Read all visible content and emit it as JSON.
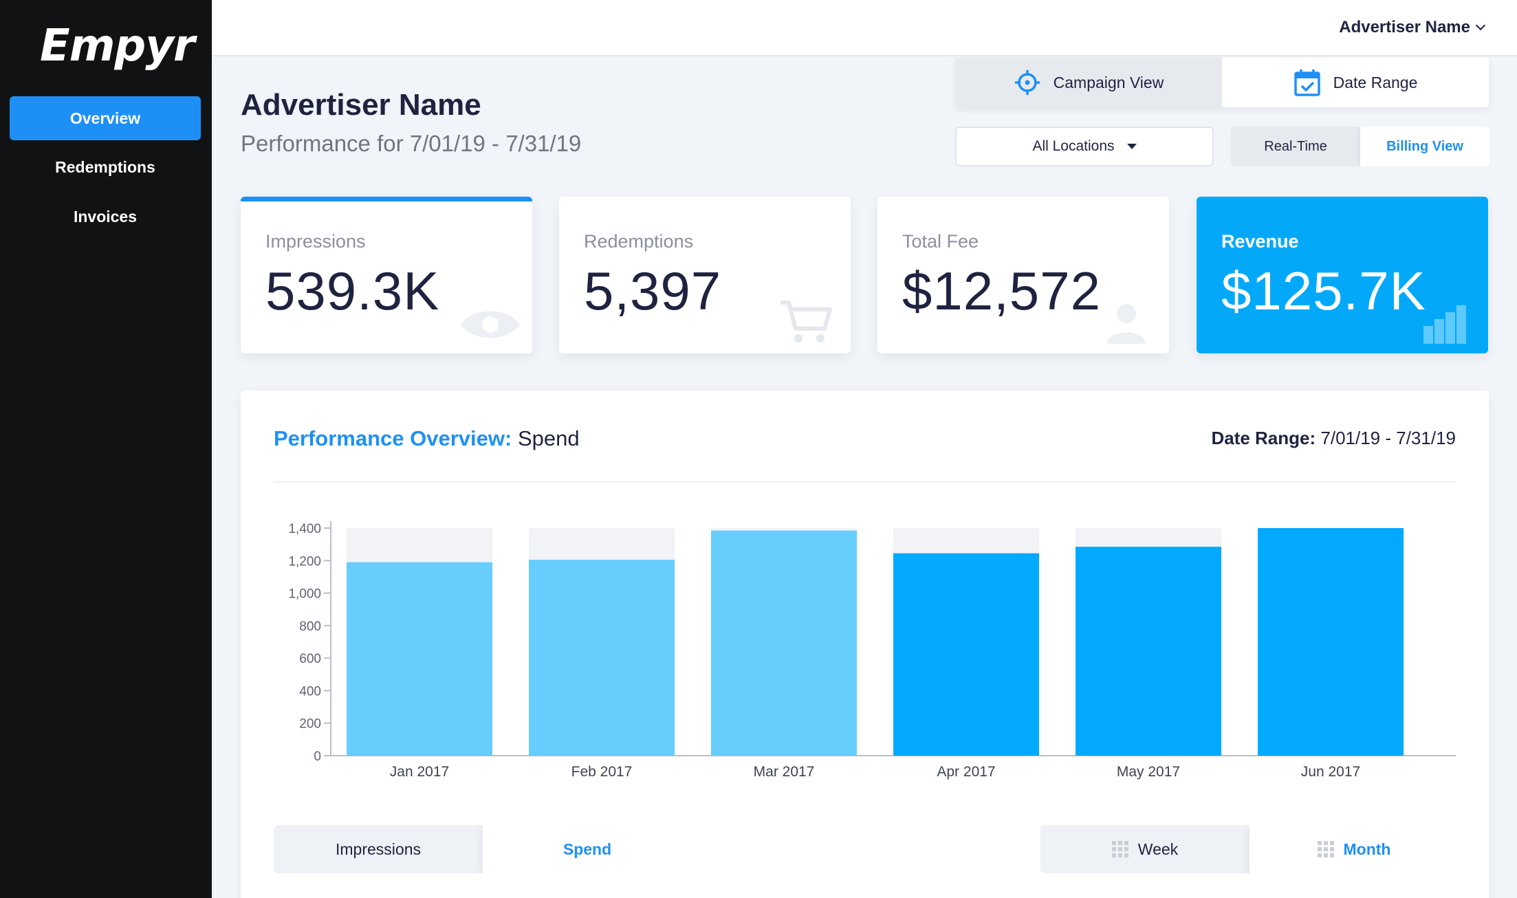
{
  "brand": "Empyr",
  "sidebar": {
    "items": [
      {
        "label": "Overview"
      },
      {
        "label": "Redemptions"
      },
      {
        "label": "Invoices"
      }
    ]
  },
  "topbar": {
    "user_label": "Advertiser Name"
  },
  "header": {
    "title": "Advertiser Name",
    "subtitle": "Performance for 7/01/19 - 7/31/19"
  },
  "view_tabs": [
    {
      "label": "Campaign View",
      "icon": "crosshair-icon"
    },
    {
      "label": "Date Range",
      "icon": "calendar-check-icon"
    }
  ],
  "location_select": {
    "value": "All Locations"
  },
  "mode_toggle": [
    "Real-Time",
    "Billing View"
  ],
  "stats": [
    {
      "label": "Impressions",
      "value": "539.3K",
      "icon": "eye-icon"
    },
    {
      "label": "Redemptions",
      "value": "5,397",
      "icon": "cart-icon"
    },
    {
      "label": "Total Fee",
      "value": "$12,572",
      "icon": "user-icon"
    },
    {
      "label": "Revenue",
      "value": "$125.7K",
      "icon": "bar-chart-icon"
    }
  ],
  "panel": {
    "title_prefix": "Performance Overview:",
    "title_metric": "Spend",
    "range_label": "Date Range:",
    "range_value": "7/01/19 - 7/31/19"
  },
  "metric_toggle": [
    "Impressions",
    "Spend"
  ],
  "period_toggle": [
    "Week",
    "Month"
  ],
  "colors": {
    "accent": "#1e90f5",
    "revenue_card": "#03a9f8",
    "bar_light": "#66cdfc",
    "bar_dark": "#03a9fc",
    "bar_track": "#f1f3f6"
  },
  "chart_data": {
    "type": "bar",
    "categories": [
      "Jan 2017",
      "Feb 2017",
      "Mar 2017",
      "Apr 2017",
      "May 2017",
      "Jun 2017"
    ],
    "series": [
      {
        "values": [
          1190,
          1205,
          1385,
          1245,
          1285,
          1400
        ]
      },
      {
        "values": [
          1400,
          1400,
          1400,
          1400,
          1400,
          1400
        ]
      }
    ],
    "ylim": [
      0,
      1400
    ],
    "yticks": [
      "0",
      "200",
      "400",
      "600",
      "800",
      "1,000",
      "1,200",
      "1,400"
    ],
    "grid": false
  }
}
